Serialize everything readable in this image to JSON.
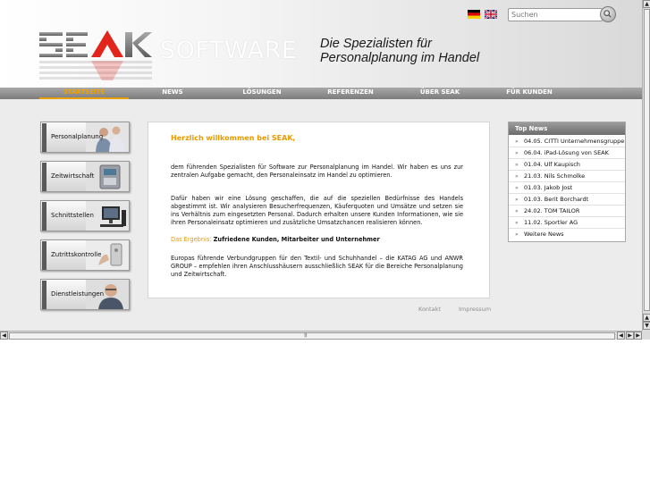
{
  "header": {
    "software_label": "SOFTWARE",
    "tagline_line1": "Die Spezialisten für",
    "tagline_line2": "Personalplanung im Handel",
    "logo_text": "SEAK",
    "search_placeholder": "Suchen"
  },
  "nav": {
    "items": [
      {
        "label": "STARTSEITE",
        "active": true
      },
      {
        "label": "NEWS",
        "active": false
      },
      {
        "label": "LÖSUNGEN",
        "active": false
      },
      {
        "label": "REFERENZEN",
        "active": false
      },
      {
        "label": "ÜBER SEAK",
        "active": false
      },
      {
        "label": "FÜR KUNDEN",
        "active": false
      }
    ]
  },
  "sidebar": {
    "items": [
      {
        "label": "Personalplanung"
      },
      {
        "label": "Zeitwirtschaft"
      },
      {
        "label": "Schnittstellen"
      },
      {
        "label": "Zutrittskontrolle"
      },
      {
        "label": "Dienstleistungen"
      }
    ]
  },
  "content": {
    "welcome": "Herzlich willkommen bei SEAK,",
    "para1": "dem führenden Spezialisten für Software zur Personalplanung im Handel. Wir haben es uns zur zentralen Aufgabe gemacht, den Personaleinsatz im Handel zu optimieren.",
    "para2": "Dafür haben wir eine Lösung geschaffen, die auf die speziellen Bedürfnisse des Handels abgestimmt ist. Wir analysieren Besucherfrequenzen, Käuferquoten und Umsätze und setzen sie ins Verhältnis zum eingesetzten Personal. Dadurch erhalten unsere Kunden Informationen, wie sie ihren Personaleinsatz optimieren und zusätzliche Umsatzchancen realisieren können.",
    "result_label": "Das Ergebnis:",
    "result_text": "Zufriedene Kunden, Mitarbeiter und Unternehmer",
    "para3": "Europas führende Verbundgruppen für den Textil- und Schuhhandel – die KATAG AG und ANWR GROUP – empfehlen ihren Anschlusshäusern ausschließlich SEAK für die Bereiche Personalplanung und Zeitwirtschaft."
  },
  "footer": {
    "kontakt": "Kontakt",
    "impressum": "Impressum"
  },
  "topnews": {
    "title": "Top News",
    "items": [
      {
        "text": "04.05. CITTI Unternehmensgruppe"
      },
      {
        "text": "06.04. iPad-Lösung von SEAK"
      },
      {
        "text": "01.04. Ulf Kaupisch"
      },
      {
        "text": "21.03. Nils Schmolke"
      },
      {
        "text": "01.03. Jakob Jost"
      },
      {
        "text": "01.03. Berit Borchardt"
      },
      {
        "text": "24.02. TOM TAILOR"
      },
      {
        "text": "11.02. Sportler AG"
      },
      {
        "text": "Weitere News"
      }
    ]
  },
  "colors": {
    "accent_orange": "#e89a00",
    "nav_gray": "#8a8a8a",
    "logo_red": "#e2251c"
  }
}
